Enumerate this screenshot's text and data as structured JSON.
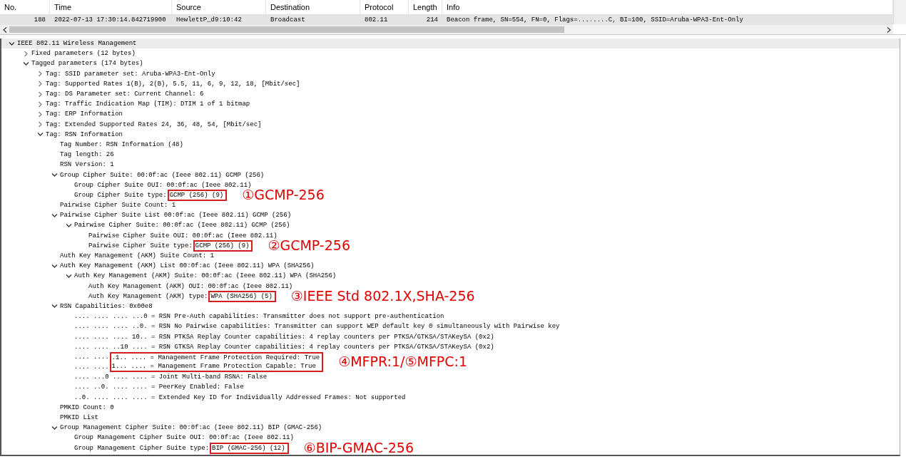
{
  "packet_list": {
    "columns": [
      {
        "label": "No."
      },
      {
        "label": "Time"
      },
      {
        "label": "Source"
      },
      {
        "label": "Destination"
      },
      {
        "label": "Protocol"
      },
      {
        "label": "Length"
      },
      {
        "label": "Info"
      }
    ],
    "rows": [
      {
        "selected": true,
        "cells": [
          "188",
          "2022-07-13 17:30:14.842719900",
          "HewlettP_d9:10:42",
          "Broadcast",
          "802.11",
          "214",
          "Beacon frame, SN=554, FN=0, Flags=........C, BI=100, SSID=Aruba-WPA3-Ent-Only"
        ]
      }
    ]
  },
  "tree": [
    {
      "text": "IEEE 802.11 Wireless Management",
      "expanded": true,
      "selected": true,
      "children": [
        {
          "text": "Fixed parameters (12 bytes)",
          "expanded": false,
          "selected": false
        },
        {
          "text": "Tagged parameters (174 bytes)",
          "expanded": true,
          "selected": false,
          "children": [
            {
              "text": "Tag: SSID parameter set: Aruba-WPA3-Ent-Only",
              "expanded": false,
              "selected": false
            },
            {
              "text": "Tag: Supported Rates 1(B), 2(B), 5.5, 11, 6, 9, 12, 18, [Mbit/sec]",
              "expanded": false,
              "selected": false
            },
            {
              "text": "Tag: DS Parameter set: Current Channel: 6",
              "expanded": false,
              "selected": false
            },
            {
              "text": "Tag: Traffic Indication Map (TIM): DTIM 1 of 1 bitmap",
              "expanded": false,
              "selected": false
            },
            {
              "text": "Tag: ERP Information",
              "expanded": false,
              "selected": false
            },
            {
              "text": "Tag: Extended Supported Rates 24, 36, 48, 54, [Mbit/sec]",
              "expanded": false,
              "selected": false
            },
            {
              "text": "Tag: RSN Information",
              "expanded": true,
              "selected": false,
              "children": [
                {
                  "text": "Tag Number: RSN Information (48)",
                  "selected": false
                },
                {
                  "text": "Tag length: 26",
                  "selected": false
                },
                {
                  "text": "RSN Version: 1",
                  "selected": false
                },
                {
                  "text": "Group Cipher Suite: 00:0f:ac (Ieee 802.11) GCMP (256)",
                  "expanded": true,
                  "selected": false,
                  "children": [
                    {
                      "text": "Group Cipher Suite OUI: 00:0f:ac (Ieee 802.11)",
                      "selected": false
                    },
                    {
                      "text": "Group Cipher Suite type:",
                      "framed": "GCMP (256) (9)",
                      "note": "①GCMP-256",
                      "selected": false
                    }
                  ]
                },
                {
                  "text": "Pairwise Cipher Suite Count: 1",
                  "selected": false
                },
                {
                  "text": "Pairwise Cipher Suite List 00:0f:ac (Ieee 802.11) GCMP (256)",
                  "expanded": true,
                  "selected": false,
                  "children": [
                    {
                      "text": "Pairwise Cipher Suite: 00:0f:ac (Ieee 802.11) GCMP (256)",
                      "expanded": true,
                      "selected": false,
                      "children": [
                        {
                          "text": "Pairwise Cipher Suite OUI: 00:0f:ac (Ieee 802.11)",
                          "selected": false
                        },
                        {
                          "text": "Pairwise Cipher Suite type:",
                          "framed": "GCMP (256) (9)",
                          "note": "②GCMP-256",
                          "selected": false
                        }
                      ]
                    }
                  ]
                },
                {
                  "text": "Auth Key Management (AKM) Suite Count: 1",
                  "selected": false
                },
                {
                  "text": "Auth Key Management (AKM) List 00:0f:ac (Ieee 802.11) WPA (SHA256)",
                  "expanded": true,
                  "selected": false,
                  "children": [
                    {
                      "text": "Auth Key Management (AKM) Suite: 00:0f:ac (Ieee 802.11) WPA (SHA256)",
                      "expanded": true,
                      "selected": false,
                      "children": [
                        {
                          "text": "Auth Key Management (AKM) OUI: 00:0f:ac (Ieee 802.11)",
                          "selected": false
                        },
                        {
                          "text": "Auth Key Management (AKM) type:",
                          "framed": "WPA (SHA256) (5)",
                          "note": "③IEEE Std 802.1X,SHA-256",
                          "selected": false
                        }
                      ]
                    }
                  ]
                },
                {
                  "text": "RSN Capabilities: 0x00e8",
                  "expanded": true,
                  "selected": false,
                  "children": [
                    {
                      "kind": "plain",
                      "text": ".... .... .... ...0 = RSN Pre-Auth capabilities: Transmitter does not support pre-authentication",
                      "selected": false
                    },
                    {
                      "kind": "plain",
                      "text": ".... .... .... ..0. = RSN No Pairwise capabilities: Transmitter can support WEP default key 0 simultaneously with Pairwise key",
                      "selected": false
                    },
                    {
                      "kind": "plain",
                      "text": ".... .... .... 10.. = RSN PTKSA Replay Counter capabilities: 4 replay counters per PTKSA/GTKSA/STAKeySA (0x2)",
                      "selected": false
                    },
                    {
                      "kind": "plain",
                      "text": ".... .... ..10 .... = RSN GTKSA Replay Counter capabilities: 4 replay counters per PTKSA/GTKSA/STAKeySA (0x2)",
                      "selected": false
                    },
                    {
                      "kind": "boxtop",
                      "text": ".... ....",
                      "framed": ".1.. .... = Management Frame Protection Required: True",
                      "note": "④MFPR:1/⑤MFPC:1",
                      "selected": false
                    },
                    {
                      "kind": "boxbottom",
                      "text": ".... ....",
                      "framed": "1... .... = Management Frame Protection Capable: True",
                      "selected": false
                    },
                    {
                      "kind": "plain",
                      "text": ".... ...0 .... .... = Joint Multi-band RSNA: False",
                      "selected": false
                    },
                    {
                      "kind": "plain",
                      "text": ".... ..0. .... .... = PeerKey Enabled: False",
                      "selected": false
                    },
                    {
                      "kind": "plain",
                      "text": "..0. .... .... .... = Extended Key ID for Individually Addressed Frames: Not supported",
                      "selected": false
                    }
                  ]
                },
                {
                  "text": "PMKID Count: 0",
                  "selected": false
                },
                {
                  "text": "PMKID List",
                  "selected": false
                },
                {
                  "text": "Group Management Cipher Suite: 00:0f:ac (Ieee 802.11) BIP (GMAC-256)",
                  "expanded": true,
                  "selected": false,
                  "children": [
                    {
                      "text": "Group Management Cipher Suite OUI: 00:0f:ac (Ieee 802.11)",
                      "selected": false
                    },
                    {
                      "text": "Group Management Cipher Suite type:",
                      "framed": "BIP (GMAC-256) (12)",
                      "note": "⑥BIP-GMAC-256",
                      "selected": false
                    }
                  ]
                }
              ]
            }
          ]
        }
      ]
    }
  ]
}
